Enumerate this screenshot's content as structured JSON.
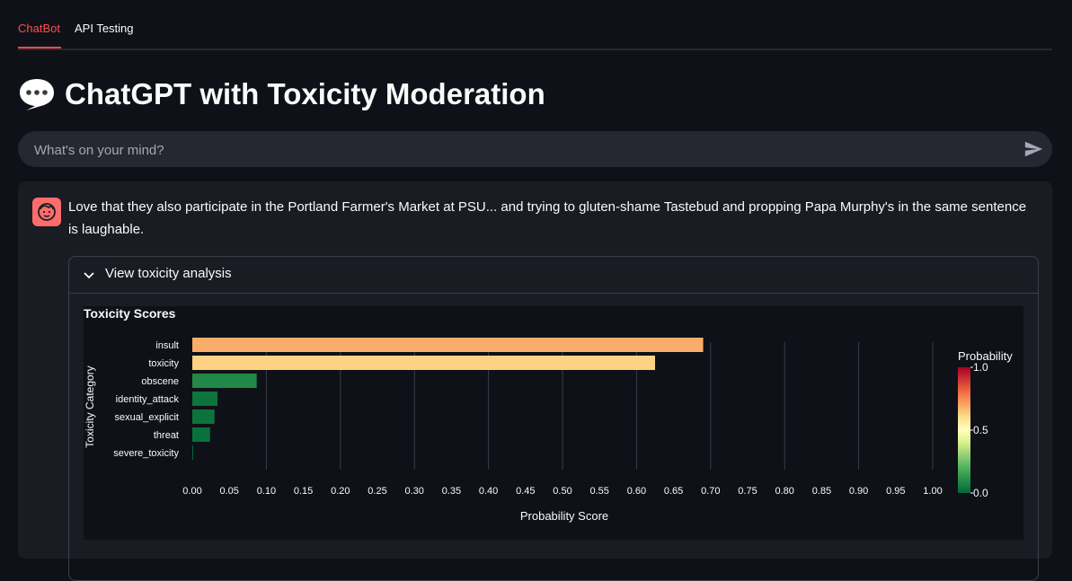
{
  "tabs": [
    {
      "label": "ChatBot",
      "active": true
    },
    {
      "label": "API Testing",
      "active": false
    }
  ],
  "page": {
    "title": "ChatGPT with Toxicity Moderation",
    "title_icon": "speech-balloon-icon"
  },
  "chat_input": {
    "placeholder": "What's on your mind?",
    "value": "",
    "send_icon": "send-icon"
  },
  "message": {
    "avatar_icon": "face-icon",
    "text": "Love that they also participate in the Portland Farmer's Market at PSU... and trying to gluten-shame Tastebud and propping Papa Murphy's in the same sentence is laughable."
  },
  "expander": {
    "label": "View toxicity analysis",
    "expanded": true
  },
  "colors": {
    "accent": "#ff4b4b",
    "background": "#0e1117",
    "surface": "#1a1c24",
    "input": "#262730"
  },
  "chart_data": {
    "type": "bar",
    "orientation": "horizontal",
    "title": "Toxicity Scores",
    "xlabel": "Probability Score",
    "ylabel": "Toxicity Category",
    "categories": [
      "insult",
      "toxicity",
      "obscene",
      "identity_attack",
      "sexual_explicit",
      "threat",
      "severe_toxicity"
    ],
    "values": [
      0.69,
      0.625,
      0.087,
      0.034,
      0.03,
      0.024,
      0.001
    ],
    "xlim": [
      0,
      1
    ],
    "xticks": [
      "0.00",
      "0.05",
      "0.10",
      "0.15",
      "0.20",
      "0.25",
      "0.30",
      "0.35",
      "0.40",
      "0.45",
      "0.50",
      "0.55",
      "0.60",
      "0.65",
      "0.70",
      "0.75",
      "0.80",
      "0.85",
      "0.90",
      "0.95",
      "1.00"
    ],
    "colorbar": {
      "title": "Probability",
      "ticks": [
        "1.0",
        "0.5",
        "0.0"
      ],
      "scale": "green-yellow-red"
    },
    "grid": "vertical"
  }
}
